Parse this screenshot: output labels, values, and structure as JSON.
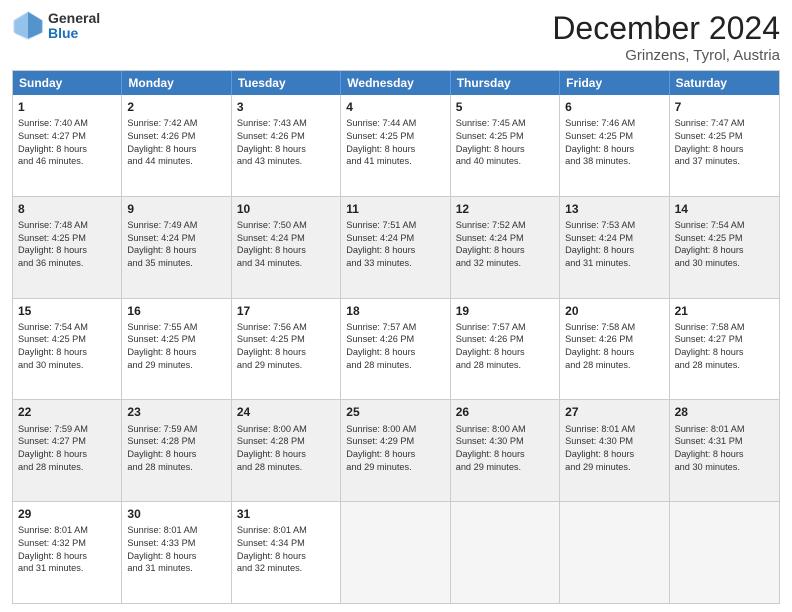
{
  "header": {
    "logo": {
      "general": "General",
      "blue": "Blue"
    },
    "title": "December 2024",
    "subtitle": "Grinzens, Tyrol, Austria"
  },
  "calendar": {
    "days_of_week": [
      "Sunday",
      "Monday",
      "Tuesday",
      "Wednesday",
      "Thursday",
      "Friday",
      "Saturday"
    ],
    "rows": [
      [
        {
          "day": "1",
          "info": "Sunrise: 7:40 AM\nSunset: 4:27 PM\nDaylight: 8 hours\nand 46 minutes.",
          "shaded": false
        },
        {
          "day": "2",
          "info": "Sunrise: 7:42 AM\nSunset: 4:26 PM\nDaylight: 8 hours\nand 44 minutes.",
          "shaded": false
        },
        {
          "day": "3",
          "info": "Sunrise: 7:43 AM\nSunset: 4:26 PM\nDaylight: 8 hours\nand 43 minutes.",
          "shaded": false
        },
        {
          "day": "4",
          "info": "Sunrise: 7:44 AM\nSunset: 4:25 PM\nDaylight: 8 hours\nand 41 minutes.",
          "shaded": false
        },
        {
          "day": "5",
          "info": "Sunrise: 7:45 AM\nSunset: 4:25 PM\nDaylight: 8 hours\nand 40 minutes.",
          "shaded": false
        },
        {
          "day": "6",
          "info": "Sunrise: 7:46 AM\nSunset: 4:25 PM\nDaylight: 8 hours\nand 38 minutes.",
          "shaded": false
        },
        {
          "day": "7",
          "info": "Sunrise: 7:47 AM\nSunset: 4:25 PM\nDaylight: 8 hours\nand 37 minutes.",
          "shaded": false
        }
      ],
      [
        {
          "day": "8",
          "info": "Sunrise: 7:48 AM\nSunset: 4:25 PM\nDaylight: 8 hours\nand 36 minutes.",
          "shaded": true
        },
        {
          "day": "9",
          "info": "Sunrise: 7:49 AM\nSunset: 4:24 PM\nDaylight: 8 hours\nand 35 minutes.",
          "shaded": true
        },
        {
          "day": "10",
          "info": "Sunrise: 7:50 AM\nSunset: 4:24 PM\nDaylight: 8 hours\nand 34 minutes.",
          "shaded": true
        },
        {
          "day": "11",
          "info": "Sunrise: 7:51 AM\nSunset: 4:24 PM\nDaylight: 8 hours\nand 33 minutes.",
          "shaded": true
        },
        {
          "day": "12",
          "info": "Sunrise: 7:52 AM\nSunset: 4:24 PM\nDaylight: 8 hours\nand 32 minutes.",
          "shaded": true
        },
        {
          "day": "13",
          "info": "Sunrise: 7:53 AM\nSunset: 4:24 PM\nDaylight: 8 hours\nand 31 minutes.",
          "shaded": true
        },
        {
          "day": "14",
          "info": "Sunrise: 7:54 AM\nSunset: 4:25 PM\nDaylight: 8 hours\nand 30 minutes.",
          "shaded": true
        }
      ],
      [
        {
          "day": "15",
          "info": "Sunrise: 7:54 AM\nSunset: 4:25 PM\nDaylight: 8 hours\nand 30 minutes.",
          "shaded": false
        },
        {
          "day": "16",
          "info": "Sunrise: 7:55 AM\nSunset: 4:25 PM\nDaylight: 8 hours\nand 29 minutes.",
          "shaded": false
        },
        {
          "day": "17",
          "info": "Sunrise: 7:56 AM\nSunset: 4:25 PM\nDaylight: 8 hours\nand 29 minutes.",
          "shaded": false
        },
        {
          "day": "18",
          "info": "Sunrise: 7:57 AM\nSunset: 4:26 PM\nDaylight: 8 hours\nand 28 minutes.",
          "shaded": false
        },
        {
          "day": "19",
          "info": "Sunrise: 7:57 AM\nSunset: 4:26 PM\nDaylight: 8 hours\nand 28 minutes.",
          "shaded": false
        },
        {
          "day": "20",
          "info": "Sunrise: 7:58 AM\nSunset: 4:26 PM\nDaylight: 8 hours\nand 28 minutes.",
          "shaded": false
        },
        {
          "day": "21",
          "info": "Sunrise: 7:58 AM\nSunset: 4:27 PM\nDaylight: 8 hours\nand 28 minutes.",
          "shaded": false
        }
      ],
      [
        {
          "day": "22",
          "info": "Sunrise: 7:59 AM\nSunset: 4:27 PM\nDaylight: 8 hours\nand 28 minutes.",
          "shaded": true
        },
        {
          "day": "23",
          "info": "Sunrise: 7:59 AM\nSunset: 4:28 PM\nDaylight: 8 hours\nand 28 minutes.",
          "shaded": true
        },
        {
          "day": "24",
          "info": "Sunrise: 8:00 AM\nSunset: 4:28 PM\nDaylight: 8 hours\nand 28 minutes.",
          "shaded": true
        },
        {
          "day": "25",
          "info": "Sunrise: 8:00 AM\nSunset: 4:29 PM\nDaylight: 8 hours\nand 29 minutes.",
          "shaded": true
        },
        {
          "day": "26",
          "info": "Sunrise: 8:00 AM\nSunset: 4:30 PM\nDaylight: 8 hours\nand 29 minutes.",
          "shaded": true
        },
        {
          "day": "27",
          "info": "Sunrise: 8:01 AM\nSunset: 4:30 PM\nDaylight: 8 hours\nand 29 minutes.",
          "shaded": true
        },
        {
          "day": "28",
          "info": "Sunrise: 8:01 AM\nSunset: 4:31 PM\nDaylight: 8 hours\nand 30 minutes.",
          "shaded": true
        }
      ],
      [
        {
          "day": "29",
          "info": "Sunrise: 8:01 AM\nSunset: 4:32 PM\nDaylight: 8 hours\nand 31 minutes.",
          "shaded": false
        },
        {
          "day": "30",
          "info": "Sunrise: 8:01 AM\nSunset: 4:33 PM\nDaylight: 8 hours\nand 31 minutes.",
          "shaded": false
        },
        {
          "day": "31",
          "info": "Sunrise: 8:01 AM\nSunset: 4:34 PM\nDaylight: 8 hours\nand 32 minutes.",
          "shaded": false
        },
        {
          "day": "",
          "info": "",
          "shaded": true,
          "empty": true
        },
        {
          "day": "",
          "info": "",
          "shaded": true,
          "empty": true
        },
        {
          "day": "",
          "info": "",
          "shaded": true,
          "empty": true
        },
        {
          "day": "",
          "info": "",
          "shaded": true,
          "empty": true
        }
      ]
    ]
  }
}
